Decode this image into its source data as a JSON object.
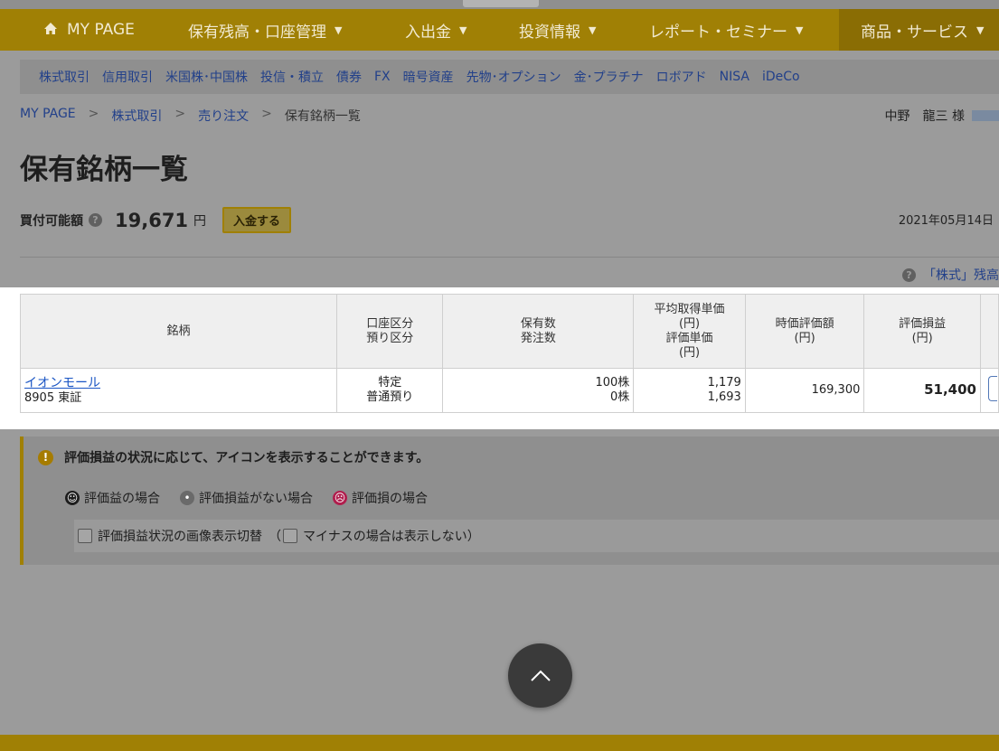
{
  "nav": {
    "items": [
      {
        "label": "MY PAGE",
        "home": true
      },
      {
        "label": "保有残高・口座管理",
        "caret": "▼"
      },
      {
        "label": "入出金",
        "caret": "▼"
      },
      {
        "label": "投資情報",
        "caret": "▼"
      },
      {
        "label": "レポート・セミナー",
        "caret": "▼"
      },
      {
        "label": "商品・サービス",
        "caret": "▼",
        "active": true
      }
    ]
  },
  "subnav": {
    "links": [
      "株式取引",
      "信用取引",
      "米国株･中国株",
      "投信・積立",
      "債券",
      "FX",
      "暗号資産",
      "先物･オプション",
      "金･プラチナ",
      "ロボアド",
      "NISA",
      "iDeCo"
    ]
  },
  "breadcrumb": {
    "items": [
      "MY PAGE",
      "株式取引",
      "売り注文"
    ],
    "separator": ">",
    "current": "保有銘柄一覧"
  },
  "user": {
    "name": "中野　龍三 様"
  },
  "page": {
    "title": "保有銘柄一覧"
  },
  "buying_power": {
    "label": "買付可能額",
    "amount": "19,671",
    "unit": "円",
    "deposit_label": "入金する"
  },
  "date": "2021年05月14日",
  "balance_link": "「株式」残高",
  "table": {
    "headers": {
      "name": "銘柄",
      "acct1": "口座区分",
      "acct2": "預り区分",
      "qty1": "保有数",
      "qty2": "発注数",
      "avg1": "平均取得単価",
      "avg2": "(円)",
      "avg3": "評価単価",
      "avg4": "(円)",
      "mv1": "時価評価額",
      "mv2": "(円)",
      "pl1": "評価損益",
      "pl2": "(円)"
    },
    "rows": [
      {
        "name": "イオンモール",
        "code": "8905 東証",
        "account": "特定",
        "custody": "普通預り",
        "holding": "100株",
        "ordered": "0株",
        "avg_cost": "1,179",
        "eval_price": "1,693",
        "market_value": "169,300",
        "pl": "51,400"
      }
    ]
  },
  "info": {
    "title": "評価損益の状況に応じて、アイコンを表示することができます。",
    "legend": {
      "gain": "評価益の場合",
      "none": "評価損益がない場合",
      "loss": "評価損の場合"
    },
    "toggle_label": "評価損益状況の画像表示切替　（",
    "toggle_sub_label": "マイナスの場合は表示しない）"
  },
  "colors": {
    "nav_gold": "#a08005",
    "link_blue": "#22408a",
    "loss_red": "#b01e4d"
  }
}
